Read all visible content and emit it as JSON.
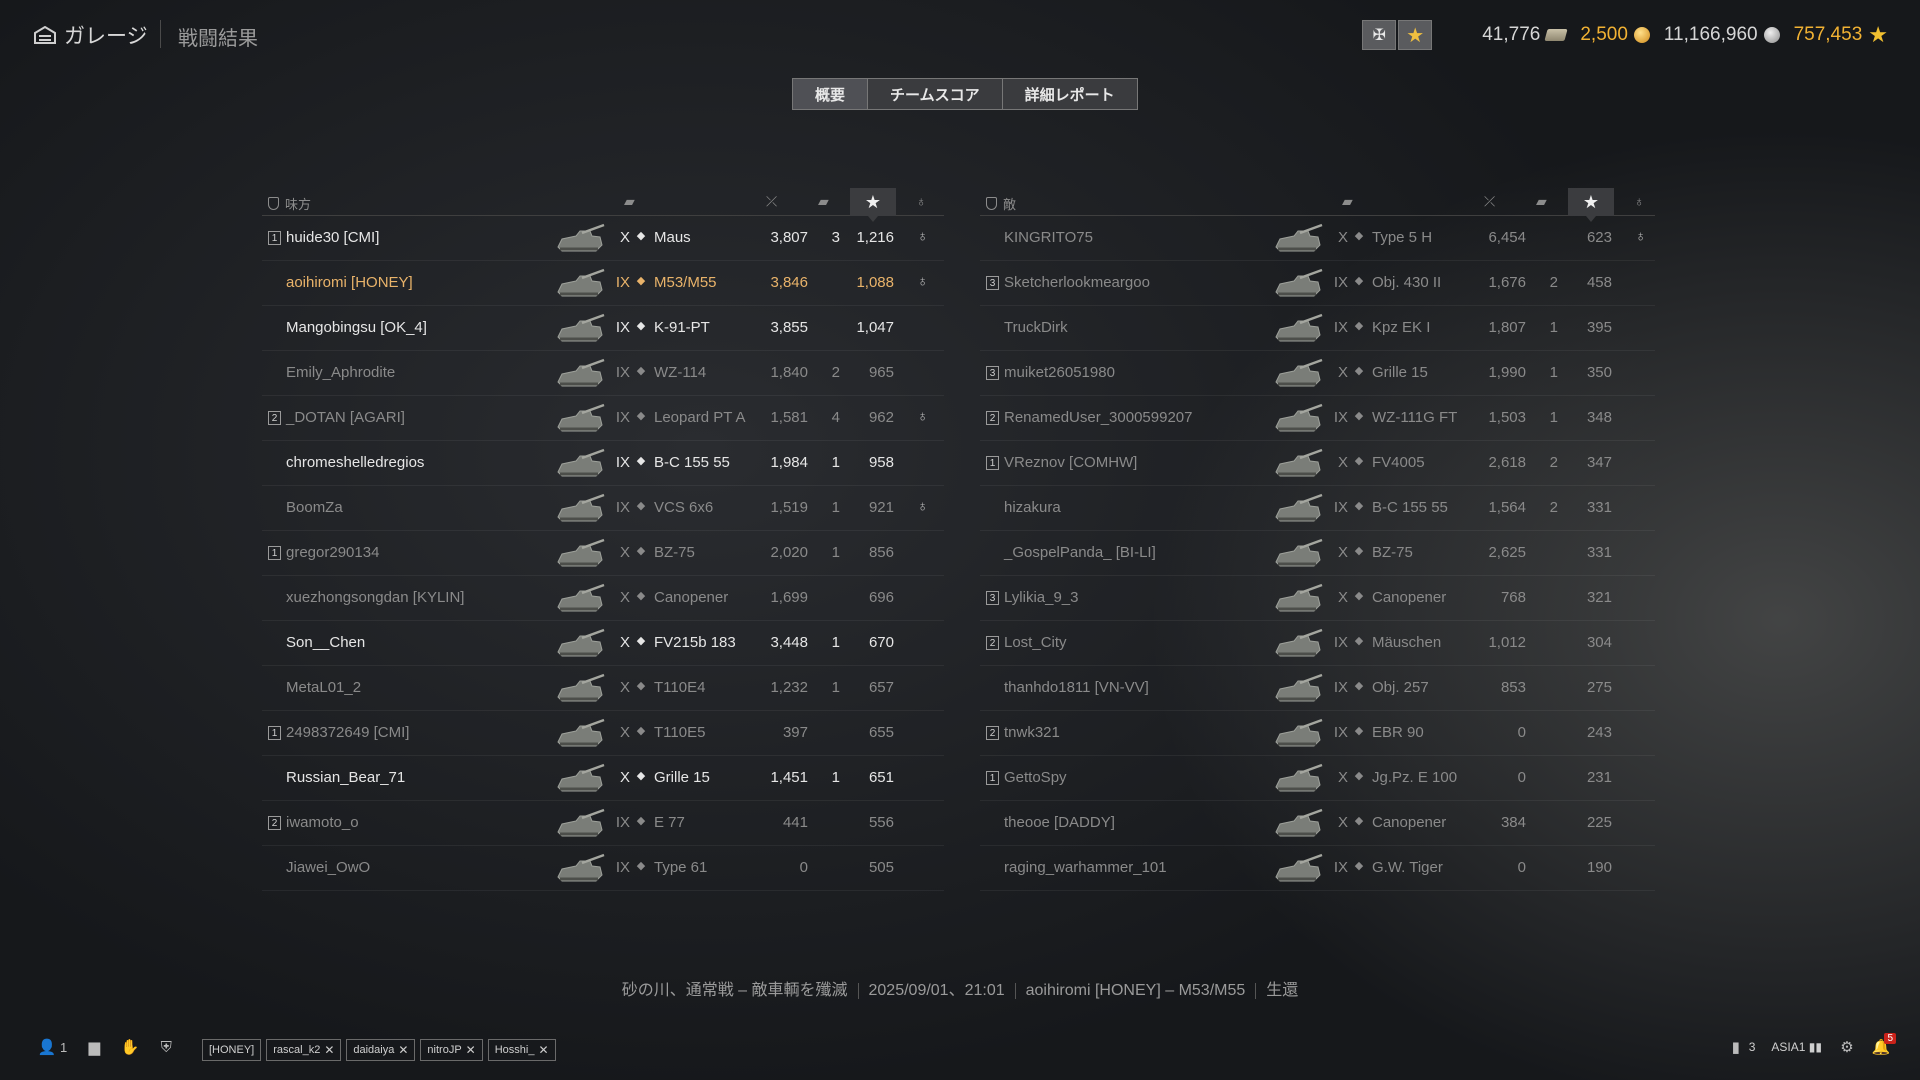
{
  "header": {
    "garage_label": "ガレージ",
    "results_label": "戦闘結果"
  },
  "currencies": {
    "bonds": "41,776",
    "gold": "2,500",
    "credits": "11,166,960",
    "free_xp": "757,453"
  },
  "tabs": [
    {
      "label": "概要",
      "active": true
    },
    {
      "label": "チームスコア",
      "active": false
    },
    {
      "label": "詳細レポート",
      "active": false
    }
  ],
  "allies": {
    "title": "味方",
    "rows": [
      {
        "badge": "1",
        "name": "huide30 [CMI]",
        "tier": "X",
        "vehicle": "Maus",
        "damage": "3,807",
        "kills": "3",
        "xp": "1,216",
        "medal": true,
        "alive": true,
        "self": false
      },
      {
        "badge": "",
        "name": "aoihiromi [HONEY]",
        "tier": "IX",
        "vehicle": "M53/M55",
        "damage": "3,846",
        "kills": "",
        "xp": "1,088",
        "medal": true,
        "alive": true,
        "self": true
      },
      {
        "badge": "",
        "name": "Mangobingsu [OK_4]",
        "tier": "IX",
        "vehicle": "K-91-PT",
        "damage": "3,855",
        "kills": "",
        "xp": "1,047",
        "medal": false,
        "alive": true,
        "self": false
      },
      {
        "badge": "",
        "name": "Emily_Aphrodite",
        "tier": "IX",
        "vehicle": "WZ-114",
        "damage": "1,840",
        "kills": "2",
        "xp": "965",
        "medal": false,
        "alive": false,
        "self": false
      },
      {
        "badge": "2",
        "name": "_DOTAN [AGARI]",
        "tier": "IX",
        "vehicle": "Leopard PT A",
        "damage": "1,581",
        "kills": "4",
        "xp": "962",
        "medal": true,
        "alive": false,
        "self": false
      },
      {
        "badge": "",
        "name": "chromeshelledregios",
        "tier": "IX",
        "vehicle": "B-C 155 55",
        "damage": "1,984",
        "kills": "1",
        "xp": "958",
        "medal": false,
        "alive": true,
        "self": false
      },
      {
        "badge": "",
        "name": "BoomZa",
        "tier": "IX",
        "vehicle": "VCS 6x6",
        "damage": "1,519",
        "kills": "1",
        "xp": "921",
        "medal": true,
        "alive": false,
        "self": false
      },
      {
        "badge": "1",
        "name": "gregor290134",
        "tier": "X",
        "vehicle": "BZ-75",
        "damage": "2,020",
        "kills": "1",
        "xp": "856",
        "medal": false,
        "alive": false,
        "self": false
      },
      {
        "badge": "",
        "name": "xuezhongsongdan [KYLIN]",
        "tier": "X",
        "vehicle": "Canopener",
        "damage": "1,699",
        "kills": "",
        "xp": "696",
        "medal": false,
        "alive": false,
        "self": false
      },
      {
        "badge": "",
        "name": "Son__Chen",
        "tier": "X",
        "vehicle": "FV215b 183",
        "damage": "3,448",
        "kills": "1",
        "xp": "670",
        "medal": false,
        "alive": true,
        "self": false
      },
      {
        "badge": "",
        "name": "MetaL01_2",
        "tier": "X",
        "vehicle": "T110E4",
        "damage": "1,232",
        "kills": "1",
        "xp": "657",
        "medal": false,
        "alive": false,
        "self": false
      },
      {
        "badge": "1",
        "name": "2498372649 [CMI]",
        "tier": "X",
        "vehicle": "T110E5",
        "damage": "397",
        "kills": "",
        "xp": "655",
        "medal": false,
        "alive": false,
        "self": false
      },
      {
        "badge": "",
        "name": "Russian_Bear_71",
        "tier": "X",
        "vehicle": "Grille 15",
        "damage": "1,451",
        "kills": "1",
        "xp": "651",
        "medal": false,
        "alive": true,
        "self": false
      },
      {
        "badge": "2",
        "name": "iwamoto_o",
        "tier": "IX",
        "vehicle": "E 77",
        "damage": "441",
        "kills": "",
        "xp": "556",
        "medal": false,
        "alive": false,
        "self": false
      },
      {
        "badge": "",
        "name": "Jiawei_OwO",
        "tier": "IX",
        "vehicle": "Type 61",
        "damage": "0",
        "kills": "",
        "xp": "505",
        "medal": false,
        "alive": false,
        "self": false
      }
    ]
  },
  "enemies": {
    "title": "敵",
    "rows": [
      {
        "badge": "",
        "name": "KINGRITO75",
        "tier": "X",
        "vehicle": "Type 5 H",
        "damage": "6,454",
        "kills": "",
        "xp": "623",
        "medal": true,
        "alive": false
      },
      {
        "badge": "3",
        "name": "Sketcherlookmeargoo",
        "tier": "IX",
        "vehicle": "Obj. 430 II",
        "damage": "1,676",
        "kills": "2",
        "xp": "458",
        "medal": false,
        "alive": false
      },
      {
        "badge": "",
        "name": "TruckDirk",
        "tier": "IX",
        "vehicle": "Kpz EK I",
        "damage": "1,807",
        "kills": "1",
        "xp": "395",
        "medal": false,
        "alive": false
      },
      {
        "badge": "3",
        "name": "muiket26051980",
        "tier": "X",
        "vehicle": "Grille 15",
        "damage": "1,990",
        "kills": "1",
        "xp": "350",
        "medal": false,
        "alive": false
      },
      {
        "badge": "2",
        "name": "RenamedUser_3000599207",
        "tier": "IX",
        "vehicle": "WZ-111G FT",
        "damage": "1,503",
        "kills": "1",
        "xp": "348",
        "medal": false,
        "alive": false
      },
      {
        "badge": "1",
        "name": "VReznov [COMHW]",
        "tier": "X",
        "vehicle": "FV4005",
        "damage": "2,618",
        "kills": "2",
        "xp": "347",
        "medal": false,
        "alive": false
      },
      {
        "badge": "",
        "name": "hizakura",
        "tier": "IX",
        "vehicle": "B-C 155 55",
        "damage": "1,564",
        "kills": "2",
        "xp": "331",
        "medal": false,
        "alive": false
      },
      {
        "badge": "",
        "name": "_GospelPanda_ [BI-LI]",
        "tier": "X",
        "vehicle": "BZ-75",
        "damage": "2,625",
        "kills": "",
        "xp": "331",
        "medal": false,
        "alive": false
      },
      {
        "badge": "3",
        "name": "Lylikia_9_3",
        "tier": "X",
        "vehicle": "Canopener",
        "damage": "768",
        "kills": "",
        "xp": "321",
        "medal": false,
        "alive": false
      },
      {
        "badge": "2",
        "name": "Lost_City",
        "tier": "IX",
        "vehicle": "Mäuschen",
        "damage": "1,012",
        "kills": "",
        "xp": "304",
        "medal": false,
        "alive": false
      },
      {
        "badge": "",
        "name": "thanhdo1811 [VN-VV]",
        "tier": "IX",
        "vehicle": "Obj. 257",
        "damage": "853",
        "kills": "",
        "xp": "275",
        "medal": false,
        "alive": false
      },
      {
        "badge": "2",
        "name": "tnwk321",
        "tier": "IX",
        "vehicle": "EBR 90",
        "damage": "0",
        "kills": "",
        "xp": "243",
        "medal": false,
        "alive": false
      },
      {
        "badge": "1",
        "name": "GettoSpy",
        "tier": "X",
        "vehicle": "Jg.Pz. E 100",
        "damage": "0",
        "kills": "",
        "xp": "231",
        "medal": false,
        "alive": false
      },
      {
        "badge": "",
        "name": "theooe [DADDY]",
        "tier": "X",
        "vehicle": "Canopener",
        "damage": "384",
        "kills": "",
        "xp": "225",
        "medal": false,
        "alive": false
      },
      {
        "badge": "",
        "name": "raging_warhammer_101",
        "tier": "IX",
        "vehicle": "G.W. Tiger",
        "damage": "0",
        "kills": "",
        "xp": "190",
        "medal": false,
        "alive": false
      }
    ]
  },
  "battle_info": {
    "map_mode": "砂の川、通常戦 – 敵車輌を殲滅",
    "datetime": "2025/09/01、21:01",
    "player": "aoihiromi [HONEY] – M53/M55",
    "status": "生還"
  },
  "bottom": {
    "online_count": "1",
    "platoon": [
      "[HONEY]",
      "rascal_k2",
      "daidaiya",
      "nitroJP",
      "Hosshi_"
    ],
    "stats_count": "3",
    "server": "ASIA1",
    "notifications": "5"
  }
}
